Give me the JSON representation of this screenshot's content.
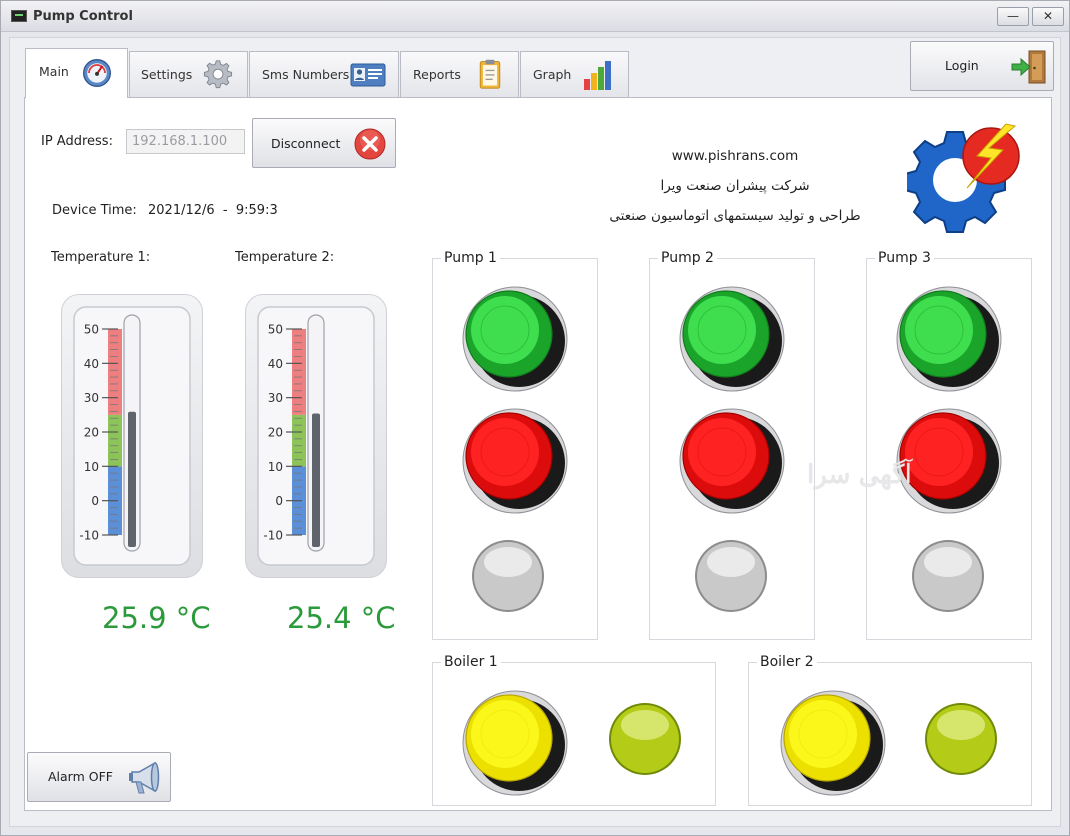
{
  "window": {
    "title": "Pump Control",
    "minimize_glyph": "—",
    "close_glyph": "✕"
  },
  "tabs": [
    {
      "label": "Main",
      "icon": "speedometer-icon",
      "active": true
    },
    {
      "label": "Settings",
      "icon": "gear-icon",
      "active": false
    },
    {
      "label": "Sms Numbers",
      "icon": "contact-card-icon",
      "active": false
    },
    {
      "label": "Reports",
      "icon": "clipboard-icon",
      "active": false
    },
    {
      "label": "Graph",
      "icon": "bar-graph-icon",
      "active": false
    }
  ],
  "login": {
    "label": "Login",
    "icon": "door-enter-icon"
  },
  "connection": {
    "ip_label": "IP Address:",
    "ip_value": "192.168.1.100",
    "disconnect_label": "Disconnect",
    "disconnect_icon": "close-circle-icon"
  },
  "device_time": {
    "label": "Device Time:",
    "value": "2021/12/6  -  9:59:3"
  },
  "company": {
    "website": "www.pishrans.com",
    "name_fa": "شرکت پیشران صنعت ویرا",
    "tagline_fa": "طراحی و تولید سیستمهای اتوماسیون صنعتی",
    "logo_icon": "gear-lightning-logo-icon"
  },
  "thermometers": [
    {
      "label": "Temperature 1:",
      "value": 25.9,
      "display": "25.9 °C"
    },
    {
      "label": "Temperature 2:",
      "value": 25.4,
      "display": "25.4 °C"
    }
  ],
  "thermometer_scale": {
    "ticks": [
      "50",
      "40",
      "30",
      "20",
      "10",
      "0",
      "-10"
    ],
    "min": -10,
    "max": 50,
    "bands": [
      {
        "from": -10,
        "to": 10,
        "color": "#5b8fd8"
      },
      {
        "from": 10,
        "to": 25,
        "color": "#8cc45a"
      },
      {
        "from": 25,
        "to": 50,
        "color": "#ee7f80"
      }
    ]
  },
  "pumps": [
    {
      "title": "Pump 1",
      "start_button": "green",
      "stop_button": "red",
      "lamp": "off"
    },
    {
      "title": "Pump 2",
      "start_button": "green",
      "stop_button": "red",
      "lamp": "off"
    },
    {
      "title": "Pump 3",
      "start_button": "green",
      "stop_button": "red",
      "lamp": "off"
    }
  ],
  "boilers": [
    {
      "title": "Boiler 1",
      "button": "yellow",
      "lamp": "on"
    },
    {
      "title": "Boiler 2",
      "button": "yellow",
      "lamp": "on"
    }
  ],
  "alarm": {
    "label": "Alarm OFF",
    "icon": "megaphone-icon"
  },
  "watermark": "آگهی سرا",
  "colors": {
    "green_button": "#22c337",
    "red_button": "#ee1111",
    "yellow_button": "#f4f000",
    "lamp_off": "#c9c9c9",
    "lamp_on": "#b4cc18",
    "temperature_text": "#2b9a3a"
  }
}
